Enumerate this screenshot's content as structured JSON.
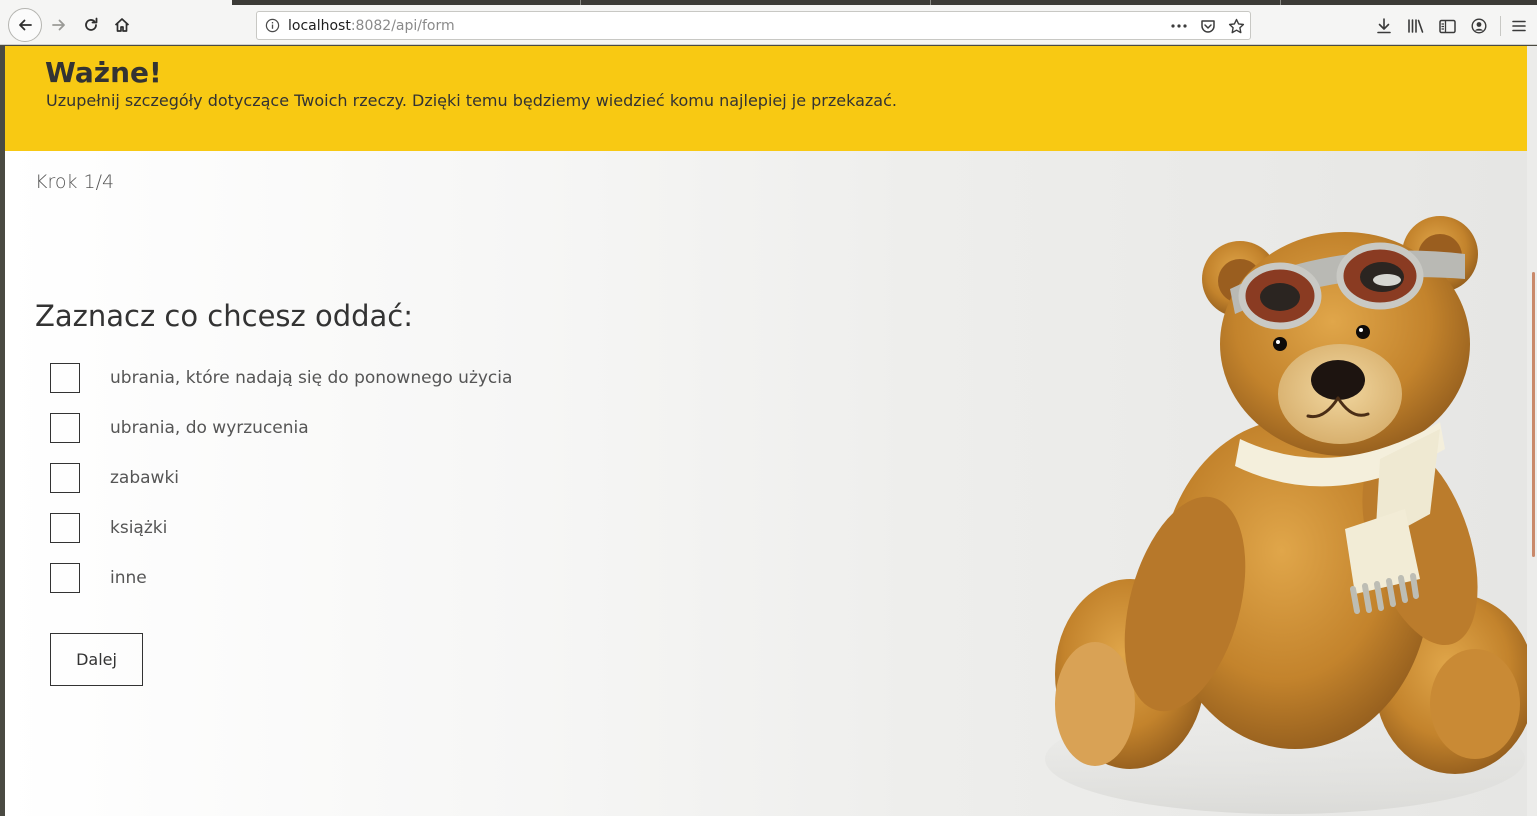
{
  "browser": {
    "url_host": "localhost",
    "url_rest": ":8082/api/form"
  },
  "banner": {
    "title": "Ważne!",
    "text": "Uzupełnij szczegóły dotyczące Twoich rzeczy. Dzięki temu będziemy wiedzieć komu najlepiej je przekazać.",
    "background_color": "#f8c913"
  },
  "form": {
    "step": "Krok 1/4",
    "question": "Zaznacz co chcesz oddać:",
    "options": [
      {
        "label": "ubrania, które nadają się do ponownego użycia",
        "checked": false
      },
      {
        "label": "ubrania, do wyrzucenia",
        "checked": false
      },
      {
        "label": "zabawki",
        "checked": false
      },
      {
        "label": "książki",
        "checked": false
      },
      {
        "label": "inne",
        "checked": false
      }
    ],
    "next_label": "Dalej"
  },
  "icons": {
    "back": "arrow-left-icon",
    "forward": "arrow-right-icon",
    "reload": "reload-icon",
    "home": "home-icon",
    "info": "info-icon",
    "page_actions": "more-icon",
    "pocket": "pocket-icon",
    "bookmark": "star-icon",
    "downloads": "download-icon",
    "library": "library-icon",
    "sidebar": "sidebar-icon",
    "account": "account-icon",
    "menu": "hamburger-icon"
  },
  "illustration": "teddy bear with aviator goggles and scarf"
}
